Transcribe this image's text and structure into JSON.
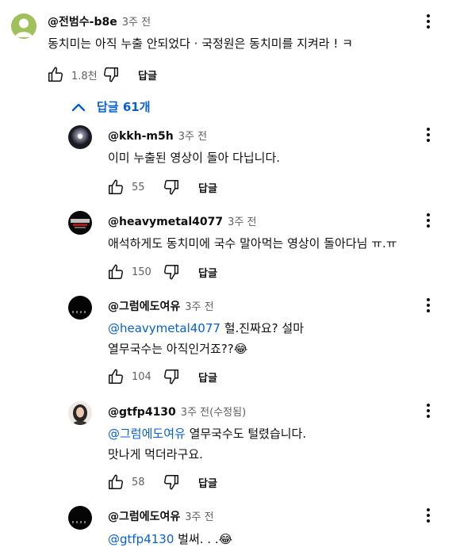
{
  "top": {
    "author": "@전범수-b8e",
    "time": "3주 전",
    "text": "동치미는 아직 누출 안되었다  ·  국정원은 동치미를 지켜라 ! ㅋ",
    "likes": "1.8천",
    "reply_label": "답글"
  },
  "toggle": {
    "label": "답글 61개"
  },
  "replies": [
    {
      "author": "@kkh-m5h",
      "time": "3주 전",
      "lines": [
        "이미 누출된 영상이 돌아 다닙니다."
      ],
      "likes": "55",
      "reply_label": "답글"
    },
    {
      "author": "@heavymetal4077",
      "time": "3주 전",
      "lines": [
        "애석하게도 동치미에 국수 말아먹는 영상이 돌아다님 ㅠ.ㅠ"
      ],
      "likes": "150",
      "reply_label": "답글"
    },
    {
      "author": "@그럼에도여유",
      "time": "3주 전",
      "mention": "@heavymetal4077",
      "line1_rest": " 헐.진짜요? 설마",
      "line2": "열무국수는 아직인거죠??😂",
      "likes": "104",
      "reply_label": "답글"
    },
    {
      "author": "@gtfp4130",
      "time": "3주 전(수정됨)",
      "mention": "@그럼에도여유",
      "line1_rest": " 열무국수도 털렸습니다.",
      "line2": "맛나게 먹더라구요.",
      "likes": "58",
      "reply_label": "답글"
    },
    {
      "author": "@그럼에도여유",
      "time": "3주 전",
      "mention": "@gtfp4130",
      "line1_rest": " 벌써. . .😂"
    }
  ],
  "colors": {
    "link": "#065fd4",
    "text": "#0f0f0f",
    "secondary": "#606060"
  },
  "icons": {
    "like": "thumb-up-icon",
    "dislike": "thumb-down-icon",
    "more": "more-vert-icon",
    "collapse": "chevron-up-icon"
  }
}
